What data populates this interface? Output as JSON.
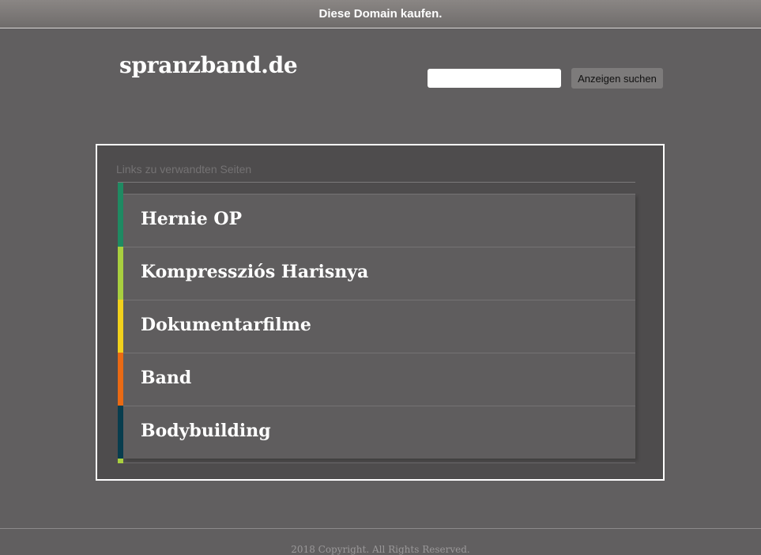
{
  "topbar": {
    "buy_link": "Diese Domain kaufen."
  },
  "header": {
    "site_title": "spranzband.de",
    "search_placeholder": "",
    "search_value": "",
    "search_button": "Anzeigen suchen"
  },
  "related": {
    "heading": "Links zu verwandten Seiten",
    "items": [
      {
        "label": "Hernie OP",
        "accent": "#1f8a62"
      },
      {
        "label": "Kompressziós Harisnya",
        "accent": "#a9cf3f"
      },
      {
        "label": "Dokumentarfilme",
        "accent": "#f2d11c"
      },
      {
        "label": "Band",
        "accent": "#ea6a14"
      },
      {
        "label": "Bodybuilding",
        "accent": "#083d4e"
      }
    ]
  },
  "footer": {
    "copyright": "2018 Copyright. All Rights Reserved."
  }
}
